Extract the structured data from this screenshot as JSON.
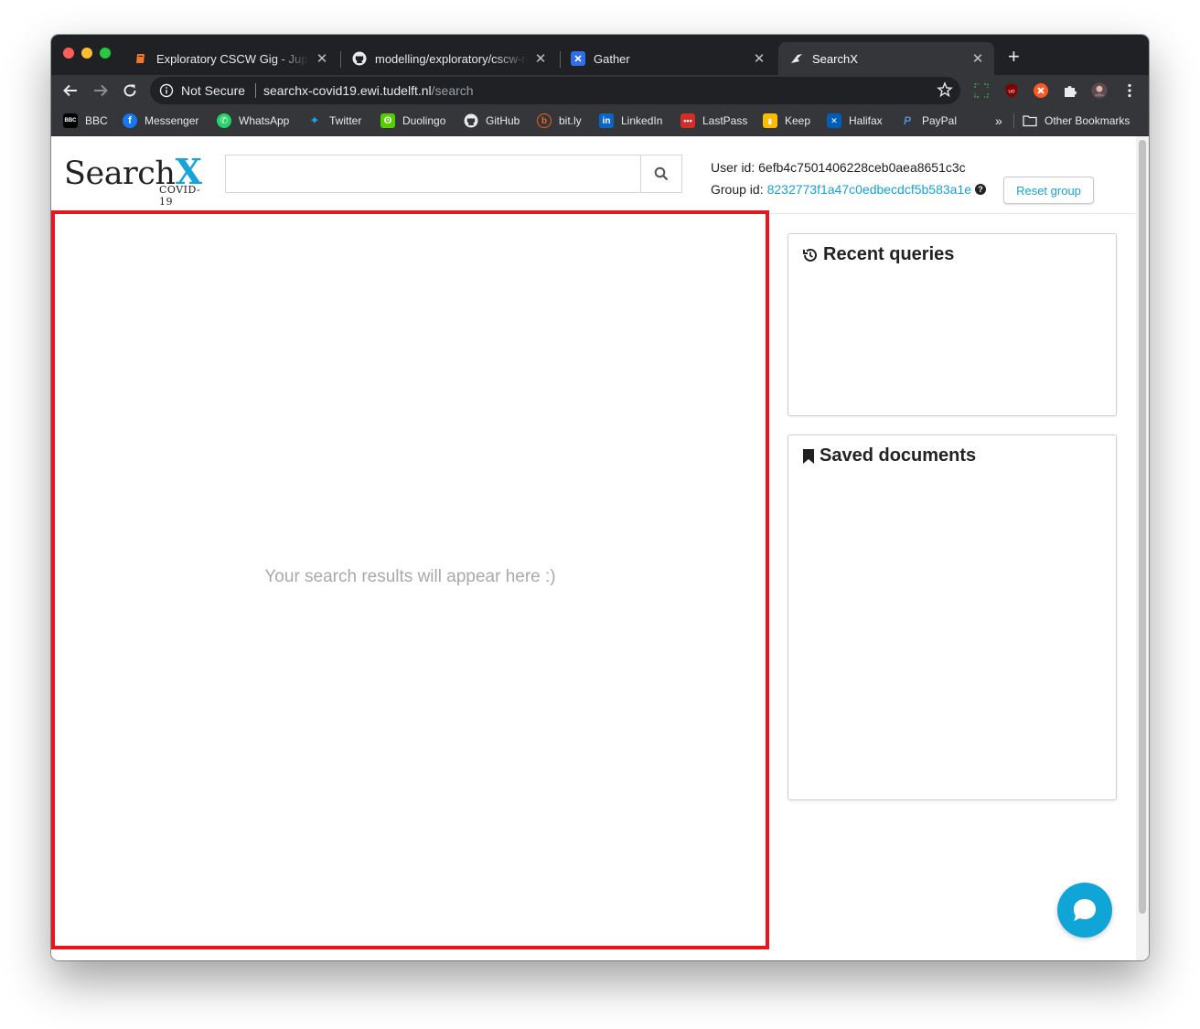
{
  "browser": {
    "tabs": [
      {
        "title": "Exploratory CSCW Gig - Jupyter",
        "icon": "jupyter-icon",
        "active": false
      },
      {
        "title": "modelling/exploratory/cscw-m",
        "icon": "github-icon",
        "active": false
      },
      {
        "title": "Gather",
        "icon": "gather-icon",
        "active": false
      },
      {
        "title": "SearchX",
        "icon": "searchx-icon",
        "active": true
      }
    ],
    "new_tab_label": "+",
    "tab_close_glyph": "✕",
    "security_label": "Not Secure",
    "url_host": "searchx-covid19.ewi.tudelft.nl",
    "url_path": "/search",
    "bookmarks": [
      {
        "label": "BBC",
        "icon": "bbc-icon",
        "color": "#000000",
        "glyph": "BBC"
      },
      {
        "label": "Messenger",
        "icon": "facebook-icon",
        "color": "#1877f2",
        "glyph": "f"
      },
      {
        "label": "WhatsApp",
        "icon": "whatsapp-icon",
        "color": "#25d366",
        "glyph": "✆"
      },
      {
        "label": "Twitter",
        "icon": "twitter-icon",
        "color": "#1da1f2",
        "glyph": "✦"
      },
      {
        "label": "Duolingo",
        "icon": "duolingo-icon",
        "color": "#58cc02",
        "glyph": "ʘ"
      },
      {
        "label": "GitHub",
        "icon": "github-icon",
        "color": "#ffffff",
        "glyph": "●"
      },
      {
        "label": "bit.ly",
        "icon": "bitly-icon",
        "color": "#ee6123",
        "glyph": "b"
      },
      {
        "label": "LinkedIn",
        "icon": "linkedin-icon",
        "color": "#0a66c2",
        "glyph": "in"
      },
      {
        "label": "LastPass",
        "icon": "lastpass-icon",
        "color": "#d32d27",
        "glyph": "•••"
      },
      {
        "label": "Keep",
        "icon": "keep-icon",
        "color": "#fbbc04",
        "glyph": "▮"
      },
      {
        "label": "Halifax",
        "icon": "halifax-icon",
        "color": "#005eb8",
        "glyph": "✕"
      },
      {
        "label": "PayPal",
        "icon": "paypal-icon",
        "color": "#253b80",
        "glyph": "P"
      }
    ],
    "overflow_label": "»",
    "other_bookmarks_label": "Other Bookmarks"
  },
  "app": {
    "logo_word": "Search",
    "logo_x": "X",
    "logo_sub": "COVID-19",
    "search_placeholder": "",
    "user_id_label": "User id:",
    "user_id": "6efb4c7501406228ceb0aea8651c3c",
    "group_id_label": "Group id:",
    "group_id": "8232773f1a47c0edbecdcf5b583a1e",
    "help_glyph": "?",
    "reset_group_label": "Reset group",
    "results_placeholder": "Your search results will appear here :)",
    "recent_queries_title": "Recent queries",
    "saved_documents_title": "Saved documents"
  },
  "colors": {
    "accent": "#16a2d7",
    "highlight_border": "#e8141e",
    "chat_button": "#0fa5d6"
  }
}
